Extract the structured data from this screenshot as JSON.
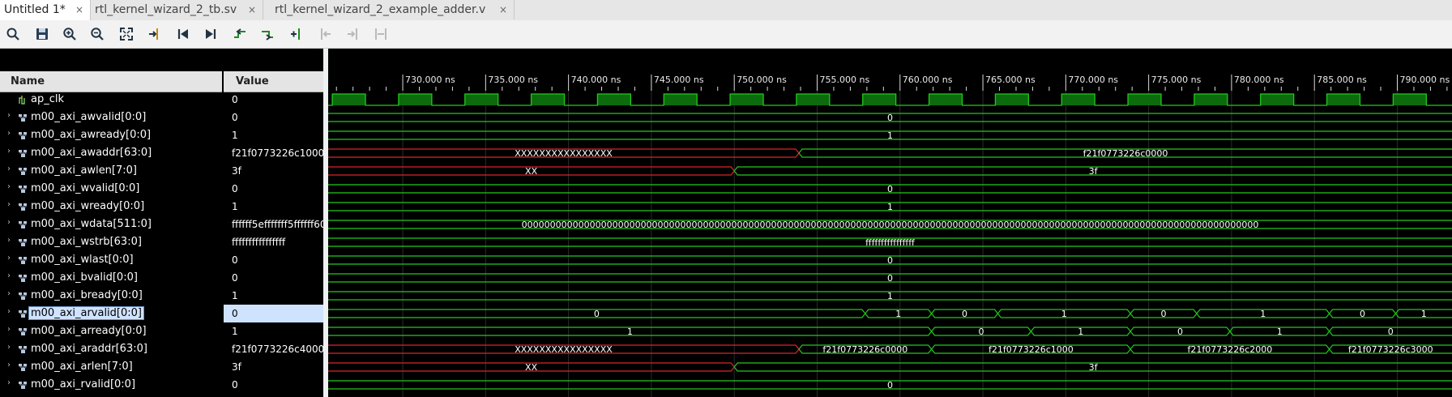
{
  "tabs": [
    {
      "label": "Untitled 1*",
      "active": true
    },
    {
      "label": "rtl_kernel_wizard_2_tb.sv",
      "active": false
    },
    {
      "label": "rtl_kernel_wizard_2_example_adder.v",
      "active": false
    }
  ],
  "tab_close_glyph": "×",
  "toolbar": {
    "buttons": [
      "search-icon",
      "save-icon",
      "zoom-in-icon",
      "zoom-out-icon",
      "zoom-fit-icon",
      "go-to-cursor-icon",
      "go-to-time-0-icon",
      "go-to-last-time-icon",
      "previous-transition-icon",
      "next-transition-icon",
      "add-marker-icon",
      "previous-marker-icon",
      "next-marker-icon",
      "swap-cursors-icon"
    ]
  },
  "columns": {
    "name": "Name",
    "value": "Value"
  },
  "signals": [
    {
      "name": "ap_clk",
      "value": "0",
      "icon": "clock-icon",
      "expandable": false
    },
    {
      "name": "m00_axi_awvalid[0:0]",
      "value": "0",
      "icon": "bus-icon",
      "expandable": true
    },
    {
      "name": "m00_axi_awready[0:0]",
      "value": "1",
      "icon": "bus-icon",
      "expandable": true
    },
    {
      "name": "m00_axi_awaddr[63:0]",
      "value": "f21f0773226c1000",
      "icon": "bus-icon",
      "expandable": true
    },
    {
      "name": "m00_axi_awlen[7:0]",
      "value": "3f",
      "icon": "bus-icon",
      "expandable": true
    },
    {
      "name": "m00_axi_wvalid[0:0]",
      "value": "0",
      "icon": "bus-icon",
      "expandable": true
    },
    {
      "name": "m00_axi_wready[0:0]",
      "value": "1",
      "icon": "bus-icon",
      "expandable": true
    },
    {
      "name": "m00_axi_wdata[511:0]",
      "value": "ffffff5efffffff5ffffff60",
      "icon": "bus-icon",
      "expandable": true
    },
    {
      "name": "m00_axi_wstrb[63:0]",
      "value": "ffffffffffffffff",
      "icon": "bus-icon",
      "expandable": true
    },
    {
      "name": "m00_axi_wlast[0:0]",
      "value": "0",
      "icon": "bus-icon",
      "expandable": true
    },
    {
      "name": "m00_axi_bvalid[0:0]",
      "value": "0",
      "icon": "bus-icon",
      "expandable": true
    },
    {
      "name": "m00_axi_bready[0:0]",
      "value": "1",
      "icon": "bus-icon",
      "expandable": true
    },
    {
      "name": "m00_axi_arvalid[0:0]",
      "value": "0",
      "icon": "bus-icon",
      "expandable": true,
      "selected": true
    },
    {
      "name": "m00_axi_arready[0:0]",
      "value": "1",
      "icon": "bus-icon",
      "expandable": true
    },
    {
      "name": "m00_axi_araddr[63:0]",
      "value": "f21f0773226c4000",
      "icon": "bus-icon",
      "expandable": true
    },
    {
      "name": "m00_axi_arlen[7:0]",
      "value": "3f",
      "icon": "bus-icon",
      "expandable": true
    },
    {
      "name": "m00_axi_rvalid[0:0]",
      "value": "0",
      "icon": "bus-icon",
      "expandable": true
    }
  ],
  "time_ruler": {
    "start": 725.5,
    "end": 793.3,
    "unit": "ns",
    "labels": [
      "730.000 ns",
      "735.000 ns",
      "740.000 ns",
      "745.000 ns",
      "750.000 ns",
      "755.000 ns",
      "760.000 ns",
      "765.000 ns",
      "770.000 ns",
      "775.000 ns",
      "780.000 ns",
      "785.000 ns",
      "790.000 ns"
    ],
    "label_times": [
      730,
      735,
      740,
      745,
      750,
      755,
      760,
      765,
      770,
      775,
      780,
      785,
      790
    ],
    "minor_step": 1
  },
  "clock": {
    "period": 4,
    "high_start": 725.75
  },
  "waves": [
    {
      "kind": "clock"
    },
    {
      "kind": "bus",
      "segs": [
        {
          "t0": null,
          "t1": null,
          "v": "0"
        }
      ]
    },
    {
      "kind": "bus",
      "segs": [
        {
          "t0": null,
          "t1": null,
          "v": "1"
        }
      ]
    },
    {
      "kind": "bus",
      "segs": [
        {
          "t0": null,
          "t1": 753.9,
          "v": "XXXXXXXXXXXXXXXX",
          "x": true
        },
        {
          "t0": 753.9,
          "t1": null,
          "v": "f21f0773226c0000"
        }
      ]
    },
    {
      "kind": "bus",
      "segs": [
        {
          "t0": null,
          "t1": 750.0,
          "v": "XX",
          "x": true
        },
        {
          "t0": 750.0,
          "t1": null,
          "v": "3f"
        }
      ]
    },
    {
      "kind": "bus",
      "segs": [
        {
          "t0": null,
          "t1": null,
          "v": "0"
        }
      ]
    },
    {
      "kind": "bus",
      "segs": [
        {
          "t0": null,
          "t1": null,
          "v": "1"
        }
      ]
    },
    {
      "kind": "bus",
      "segs": [
        {
          "t0": null,
          "t1": null,
          "v": "0000000000000000000000000000000000000000000000000000000000000000000000000000000000000000000000000000000000000000000000000000000000"
        }
      ]
    },
    {
      "kind": "bus",
      "segs": [
        {
          "t0": null,
          "t1": null,
          "v": "ffffffffffffffff"
        }
      ]
    },
    {
      "kind": "bus",
      "segs": [
        {
          "t0": null,
          "t1": null,
          "v": "0"
        }
      ]
    },
    {
      "kind": "bus",
      "segs": [
        {
          "t0": null,
          "t1": null,
          "v": "0"
        }
      ]
    },
    {
      "kind": "bus",
      "segs": [
        {
          "t0": null,
          "t1": null,
          "v": "1"
        }
      ]
    },
    {
      "kind": "bus",
      "segs": [
        {
          "t0": null,
          "t1": 757.9,
          "v": "0"
        },
        {
          "t0": 757.9,
          "t1": 761.9,
          "v": "1"
        },
        {
          "t0": 761.9,
          "t1": 765.9,
          "v": "0"
        },
        {
          "t0": 765.9,
          "t1": 773.9,
          "v": "1"
        },
        {
          "t0": 773.9,
          "t1": 777.9,
          "v": "0"
        },
        {
          "t0": 777.9,
          "t1": 785.9,
          "v": "1"
        },
        {
          "t0": 785.9,
          "t1": 789.9,
          "v": "0"
        },
        {
          "t0": 789.9,
          "t1": null,
          "v": "1"
        }
      ]
    },
    {
      "kind": "bus",
      "segs": [
        {
          "t0": null,
          "t1": 761.9,
          "v": "1"
        },
        {
          "t0": 761.9,
          "t1": 767.9,
          "v": "0"
        },
        {
          "t0": 767.9,
          "t1": 773.9,
          "v": "1"
        },
        {
          "t0": 773.9,
          "t1": 779.9,
          "v": "0"
        },
        {
          "t0": 779.9,
          "t1": 785.9,
          "v": "1"
        },
        {
          "t0": 785.9,
          "t1": null,
          "v": "0"
        }
      ]
    },
    {
      "kind": "bus",
      "segs": [
        {
          "t0": null,
          "t1": 753.9,
          "v": "XXXXXXXXXXXXXXXX",
          "x": true
        },
        {
          "t0": 753.9,
          "t1": 761.9,
          "v": "f21f0773226c0000"
        },
        {
          "t0": 761.9,
          "t1": 773.9,
          "v": "f21f0773226c1000"
        },
        {
          "t0": 773.9,
          "t1": 785.9,
          "v": "f21f0773226c2000"
        },
        {
          "t0": 785.9,
          "t1": null,
          "v": "f21f0773226c3000"
        }
      ]
    },
    {
      "kind": "bus",
      "segs": [
        {
          "t0": null,
          "t1": 750.0,
          "v": "XX",
          "x": true
        },
        {
          "t0": 750.0,
          "t1": null,
          "v": "3f"
        }
      ]
    },
    {
      "kind": "bus",
      "segs": [
        {
          "t0": null,
          "t1": null,
          "v": "0"
        }
      ]
    }
  ],
  "colors": {
    "wave": "#22c81e",
    "clock_fill": "#0c6b0c",
    "xstate": "#d9252a",
    "ruler_bg": "#000000"
  }
}
